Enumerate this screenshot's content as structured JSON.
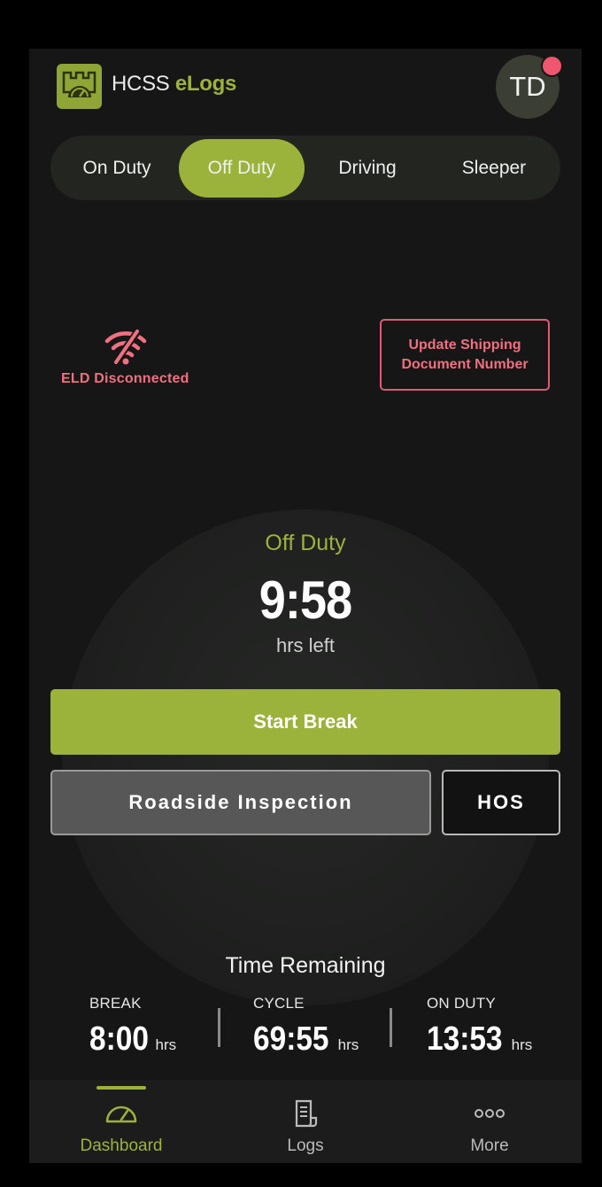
{
  "header": {
    "app_name_part1": "HCSS",
    "app_name_part2": "eLogs",
    "avatar_initials": "TD"
  },
  "duty_tabs": [
    {
      "label": "On Duty",
      "active": false
    },
    {
      "label": "Off Duty",
      "active": true
    },
    {
      "label": "Driving",
      "active": false
    },
    {
      "label": "Sleeper",
      "active": false
    }
  ],
  "eld": {
    "status": "ELD Disconnected",
    "icon": "wifi-off-icon"
  },
  "update_shipping_label": "Update Shipping Document Number",
  "current_status": {
    "name": "Off Duty",
    "time": "9:58",
    "caption": "hrs left"
  },
  "actions": {
    "start_break": "Start Break",
    "roadside": "Roadside Inspection",
    "hos": "HOS"
  },
  "time_remaining": {
    "title": "Time Remaining",
    "items": [
      {
        "label": "BREAK",
        "value": "8:00",
        "unit": "hrs"
      },
      {
        "label": "CYCLE",
        "value": "69:55",
        "unit": "hrs"
      },
      {
        "label": "ON DUTY",
        "value": "13:53",
        "unit": "hrs"
      }
    ]
  },
  "bottom_nav": [
    {
      "label": "Dashboard",
      "icon": "gauge-icon",
      "active": true
    },
    {
      "label": "Logs",
      "icon": "document-icon",
      "active": false
    },
    {
      "label": "More",
      "icon": "more-icon",
      "active": false
    }
  ],
  "colors": {
    "accent": "#9bb33a",
    "alert": "#f07080",
    "background": "#161616",
    "notification": "#f0566d"
  }
}
